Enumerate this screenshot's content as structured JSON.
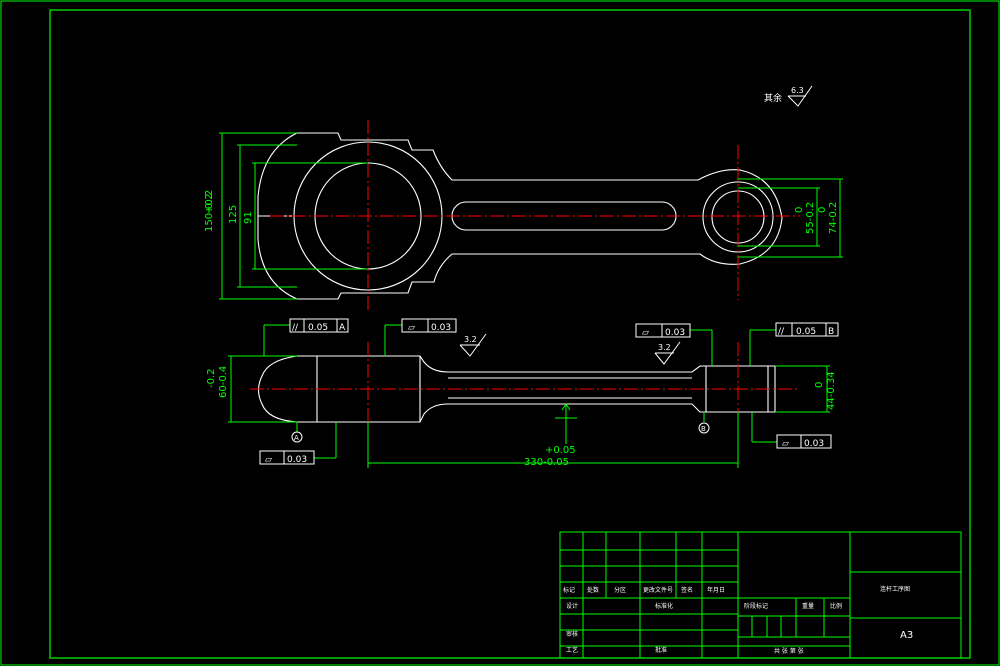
{
  "roughness_note": {
    "label": "其余",
    "value": "6.3"
  },
  "top_view_dims": {
    "overall_height": "150-0.2",
    "overall_height_tol": "+0.2",
    "height_125": "125",
    "bore_91": "91",
    "small_end_dia": "55-0.2",
    "small_end_dia_tol": "0",
    "small_end_outer": "74-0.2",
    "small_end_outer_tol": "0"
  },
  "side_view_dims": {
    "big_end_thickness": "60-0.4",
    "big_end_thickness_tol": "-0.2",
    "small_end_thickness": "44-0.34",
    "small_end_thickness_tol": "0",
    "center_distance": "330-0.05",
    "center_distance_tol": "+0.05",
    "roughness_1": "3.2",
    "roughness_2": "3.2"
  },
  "tolerance_frames": [
    {
      "symbol": "//",
      "value": "0.05",
      "datum": "A"
    },
    {
      "symbol": "▱",
      "value": "0.03",
      "datum": ""
    },
    {
      "symbol": "▱",
      "value": "0.03",
      "datum": ""
    },
    {
      "symbol": "//",
      "value": "0.05",
      "datum": "B"
    },
    {
      "symbol": "▱",
      "value": "0.03",
      "datum": ""
    },
    {
      "symbol": "▱",
      "value": "0.03",
      "datum": ""
    }
  ],
  "datums": [
    "A",
    "B"
  ],
  "title_block": {
    "row_labels": [
      "标记",
      "处数",
      "分区",
      "更改文件号",
      "签名",
      "年月日"
    ],
    "design": "设计",
    "standardization": "标准化",
    "stage_mark": "阶段标记",
    "weight": "重量",
    "scale": "比例",
    "review": "审核",
    "process": "工艺",
    "approve": "批准",
    "sheets": "共 张 第 张",
    "drawing_name": "连杆工序图",
    "sheet_size": "A3"
  }
}
